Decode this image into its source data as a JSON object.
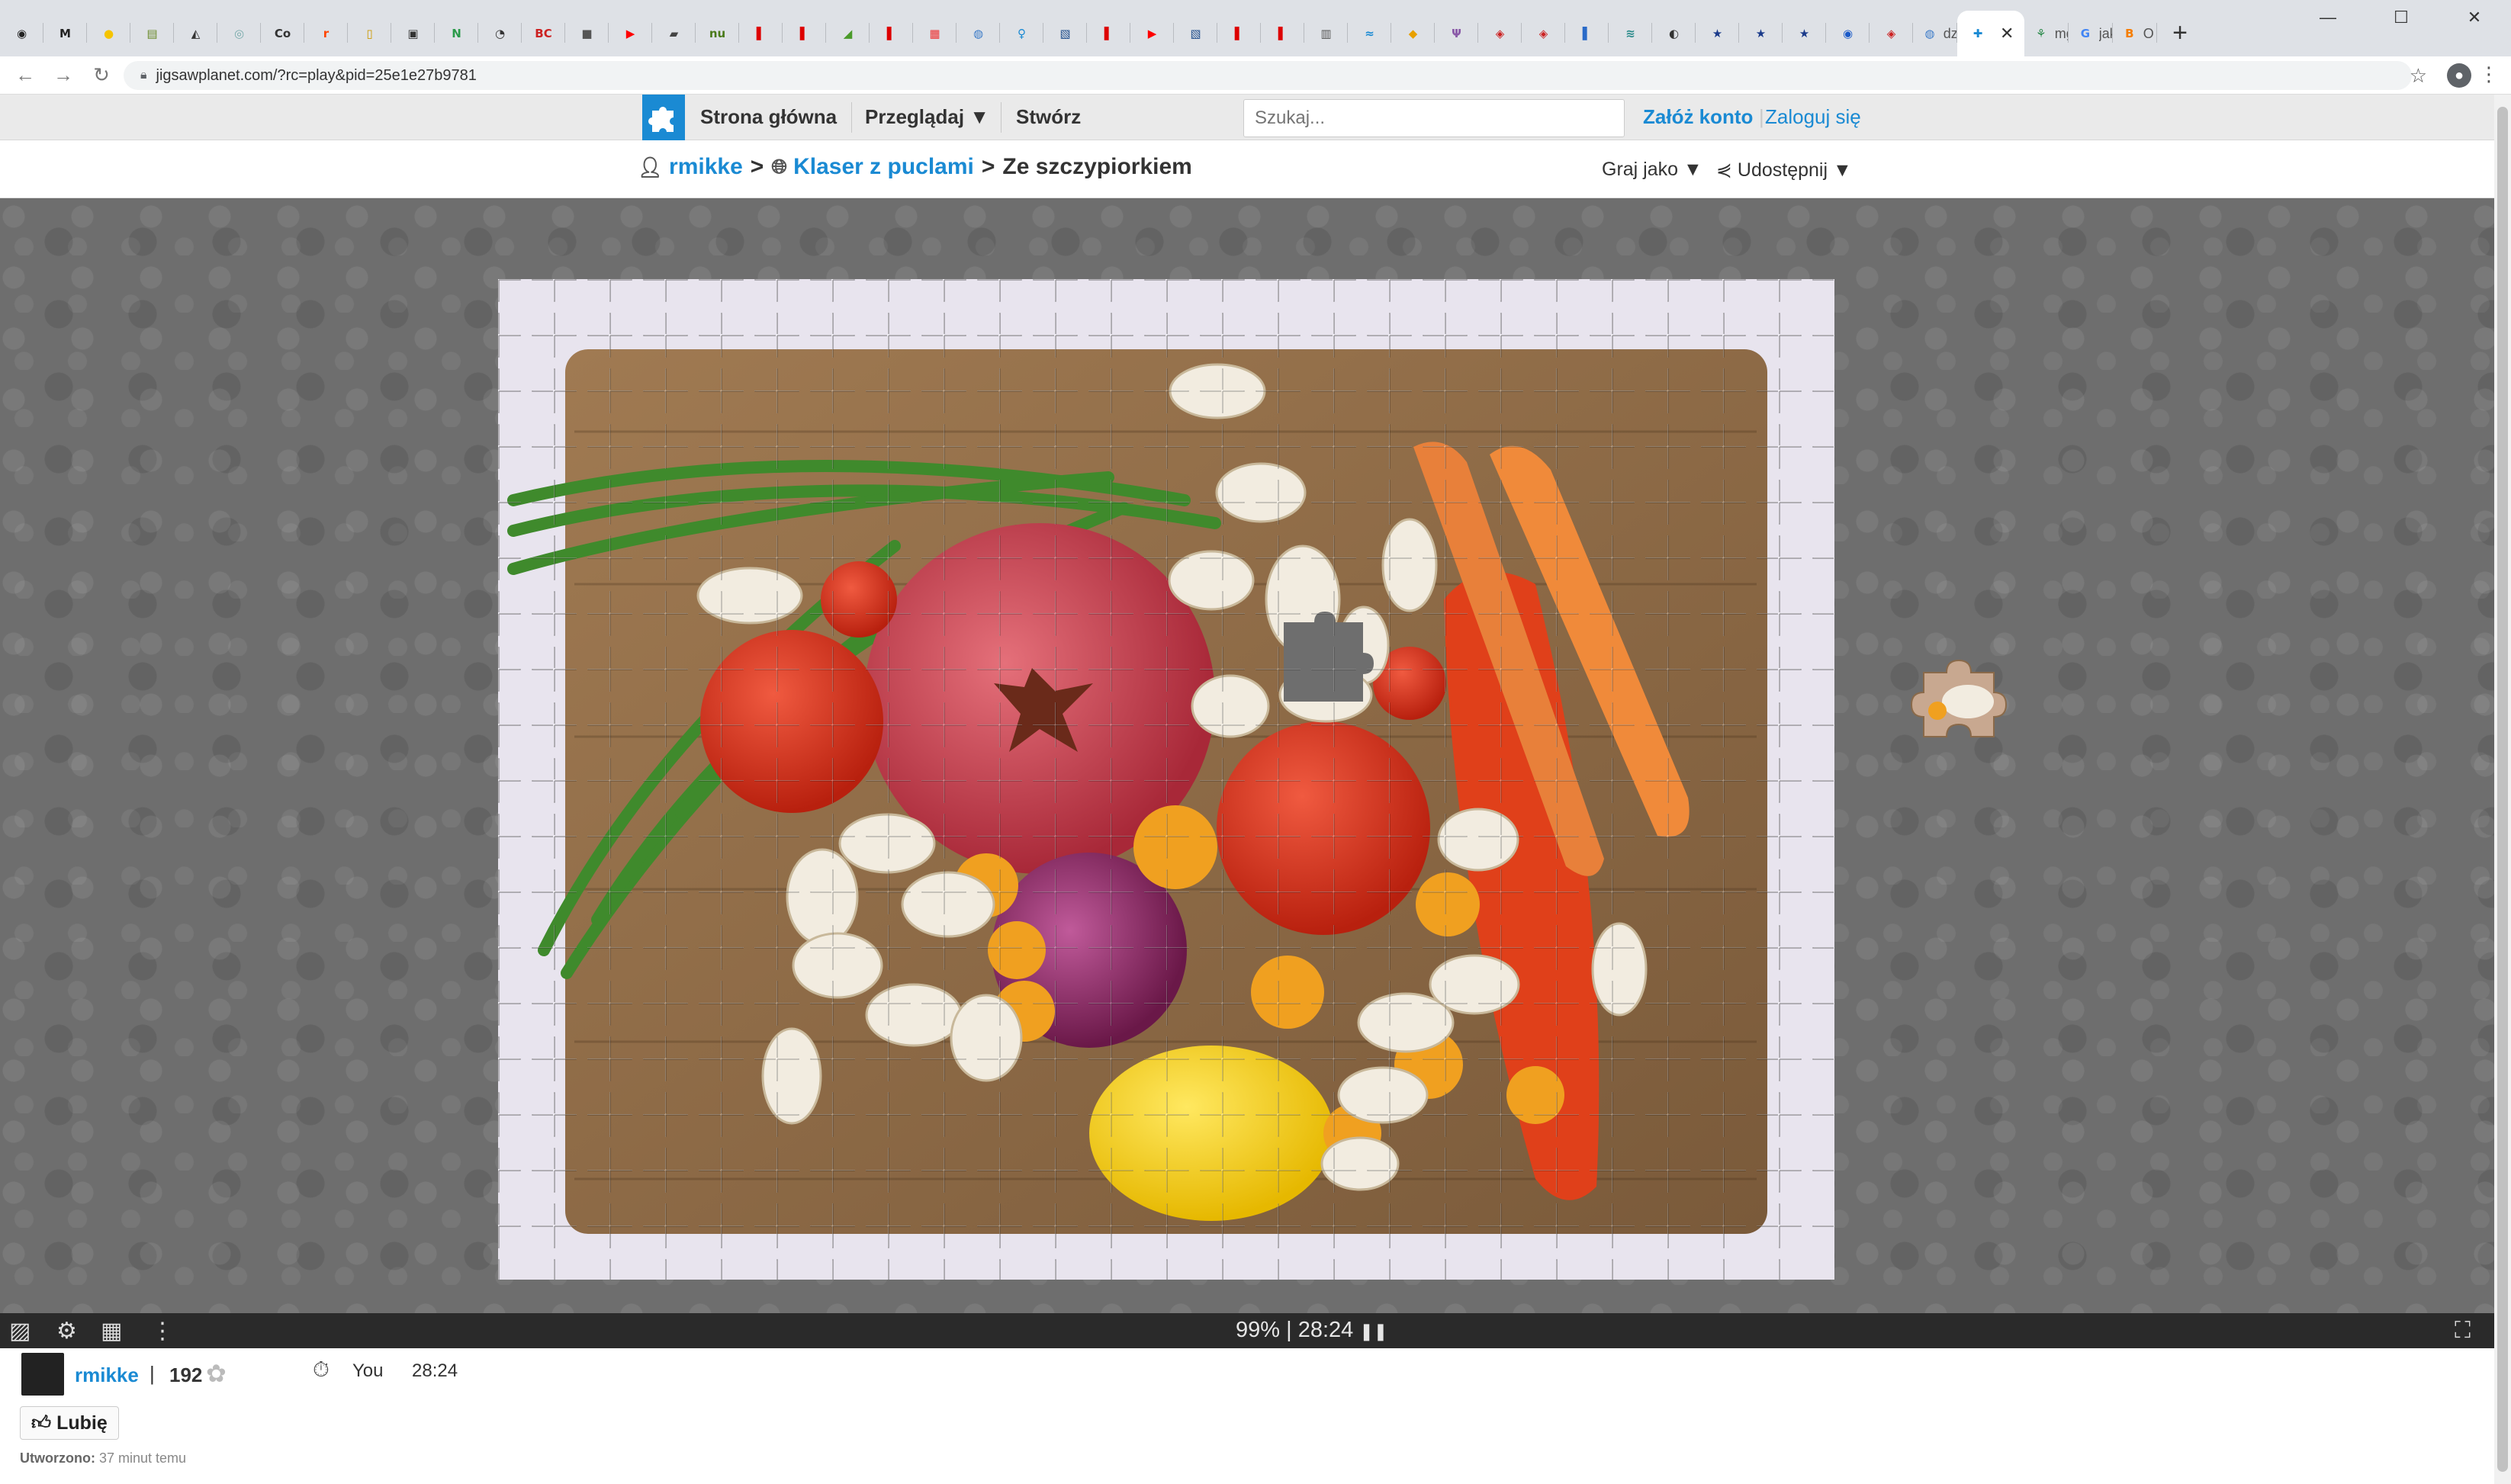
{
  "browser": {
    "tabs": [
      {
        "icon": "github-icon",
        "glyph": "◉",
        "color": "#222"
      },
      {
        "icon": "gmail-icon",
        "glyph": "M",
        "color": "#222"
      },
      {
        "icon": "sun-icon",
        "glyph": "●",
        "color": "#f5c400"
      },
      {
        "icon": "calendar-icon",
        "glyph": "▤",
        "color": "#6a8a2a"
      },
      {
        "icon": "linux-icon",
        "glyph": "◭",
        "color": "#333"
      },
      {
        "icon": "globe-icon",
        "glyph": "◎",
        "color": "#7aa"
      },
      {
        "icon": "co-icon",
        "glyph": "Co",
        "color": "#333"
      },
      {
        "icon": "reddit-icon",
        "glyph": "r",
        "color": "#ff4500"
      },
      {
        "icon": "doc-icon",
        "glyph": "▯",
        "color": "#c90"
      },
      {
        "icon": "ocr-icon",
        "glyph": "▣",
        "color": "#333"
      },
      {
        "icon": "n-icon",
        "glyph": "N",
        "color": "#2a9a4a"
      },
      {
        "icon": "clock-icon",
        "glyph": "◔",
        "color": "#333"
      },
      {
        "icon": "bc-icon",
        "glyph": "BC",
        "color": "#c22"
      },
      {
        "icon": "box-icon",
        "glyph": "■",
        "color": "#555"
      },
      {
        "icon": "youtube-icon",
        "glyph": "▶",
        "color": "#f00"
      },
      {
        "icon": "car-icon",
        "glyph": "▰",
        "color": "#444"
      },
      {
        "icon": "nu-icon",
        "glyph": "nu",
        "color": "#4a7a1a"
      },
      {
        "icon": "flag-icon",
        "glyph": "▌",
        "color": "#d00"
      },
      {
        "icon": "flag-icon",
        "glyph": "▌",
        "color": "#d00"
      },
      {
        "icon": "leaf-icon",
        "glyph": "◢",
        "color": "#4a9a2a"
      },
      {
        "icon": "flag-icon",
        "glyph": "▌",
        "color": "#d00"
      },
      {
        "icon": "grid-icon",
        "glyph": "▦",
        "color": "#e33"
      },
      {
        "icon": "un-icon",
        "glyph": "◍",
        "color": "#3a7ac8"
      },
      {
        "icon": "light-icon",
        "glyph": "♀",
        "color": "#1a8ad3"
      },
      {
        "icon": "photo-icon",
        "glyph": "▧",
        "color": "#1a4a8a"
      },
      {
        "icon": "flag-icon",
        "glyph": "▌",
        "color": "#d00"
      },
      {
        "icon": "youtube-icon",
        "glyph": "▶",
        "color": "#f00"
      },
      {
        "icon": "photo-icon",
        "glyph": "▧",
        "color": "#1a4a8a"
      },
      {
        "icon": "flag-icon",
        "glyph": "▌",
        "color": "#d00"
      },
      {
        "icon": "flag-icon",
        "glyph": "▌",
        "color": "#d00"
      },
      {
        "icon": "book-icon",
        "glyph": "▥",
        "color": "#555"
      },
      {
        "icon": "bird-icon",
        "glyph": "≈",
        "color": "#1a8ad3"
      },
      {
        "icon": "cube-icon",
        "glyph": "◆",
        "color": "#e8a000"
      },
      {
        "icon": "wing-icon",
        "glyph": "Ψ",
        "color": "#8a5aa8"
      },
      {
        "icon": "seal-icon",
        "glyph": "◈",
        "color": "#c22"
      },
      {
        "icon": "seal-icon",
        "glyph": "◈",
        "color": "#c22"
      },
      {
        "icon": "bookmark-icon",
        "glyph": "▌",
        "color": "#2a6ac8"
      },
      {
        "icon": "map-icon",
        "glyph": "≋",
        "color": "#2a8a8a"
      },
      {
        "icon": "person-icon",
        "glyph": "◐",
        "color": "#333"
      },
      {
        "icon": "star-icon",
        "glyph": "★",
        "color": "#1a3a8a"
      },
      {
        "icon": "star-icon",
        "glyph": "★",
        "color": "#1a3a8a"
      },
      {
        "icon": "star-icon",
        "glyph": "★",
        "color": "#1a3a8a"
      },
      {
        "icon": "circle-icon",
        "glyph": "◉",
        "color": "#1a5ac8"
      },
      {
        "icon": "seal-icon",
        "glyph": "◈",
        "color": "#c22"
      }
    ],
    "wide_tabs": [
      {
        "icon": "globe-icon",
        "glyph": "◍",
        "color": "#3a7ac8",
        "label": "dzi"
      }
    ],
    "active_tab": {
      "icon": "puzzle-icon",
      "glyph": "✚",
      "color": "#1a8ad3"
    },
    "after_tabs": [
      {
        "icon": "plant-icon",
        "glyph": "⚘",
        "color": "#2a8a4a",
        "label": "mg"
      },
      {
        "icon": "google-icon",
        "glyph": "G",
        "color": "#4285f4",
        "label": "jak"
      },
      {
        "icon": "blogger-icon",
        "glyph": "B",
        "color": "#f57d00",
        "label": "O C"
      }
    ],
    "url": "jigsawplanet.com/?rc=play&pid=25e1e27b9781"
  },
  "site": {
    "menu": [
      "Strona główna",
      "Przeglądaj",
      "Stwórz"
    ],
    "search_placeholder": "Szukaj...",
    "signup": "Załóż konto",
    "login": "Zaloguj się"
  },
  "breadcrumb": {
    "user": "rmikke",
    "sep1": ">",
    "collection": "Klaser z puclami",
    "sep2": ">",
    "puzzle": "Ze szczypiorkiem",
    "play_as": "Graj jako",
    "share": "Udostępnij"
  },
  "toolbar": {
    "progress_percent": "99%",
    "separator": "|",
    "time": "28:24"
  },
  "info": {
    "author": "rmikke",
    "pipe": "|",
    "score": "192",
    "player": "You",
    "player_time": "28:24",
    "like": "Lubię",
    "created_label": "Utworzono:",
    "created_value": "37 minut temu"
  },
  "colors": {
    "accent": "#1a8ad3",
    "board_bg": "#6e6e6e",
    "toolbar_bg": "#2a2a2a"
  }
}
